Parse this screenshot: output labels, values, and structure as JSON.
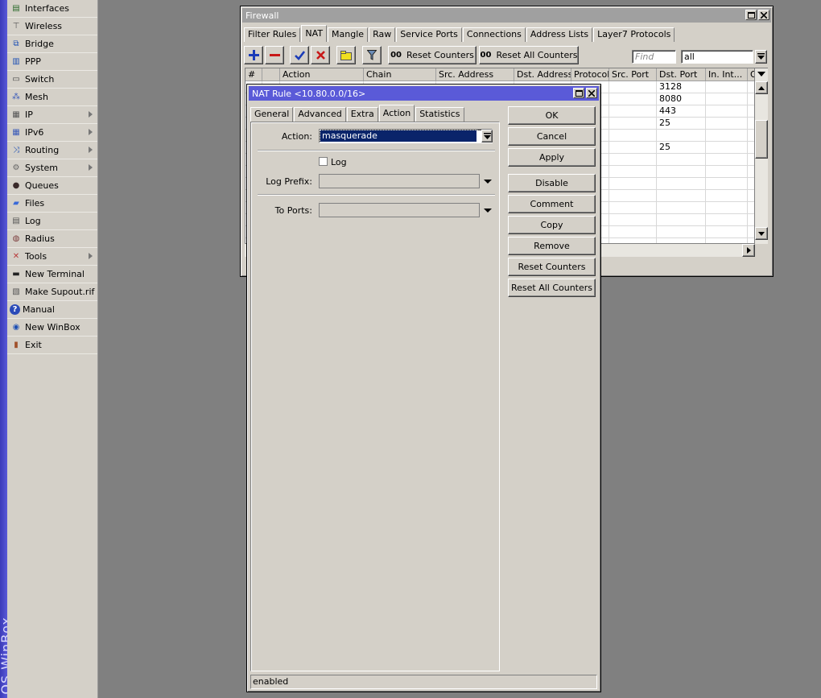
{
  "brand": {
    "text": "OS WinBox"
  },
  "menu": {
    "items": [
      {
        "label": "Interfaces",
        "icon": "interfaces-icon",
        "submenu": false
      },
      {
        "label": "Wireless",
        "icon": "wireless-icon",
        "submenu": false
      },
      {
        "label": "Bridge",
        "icon": "bridge-icon",
        "submenu": false
      },
      {
        "label": "PPP",
        "icon": "ppp-icon",
        "submenu": false
      },
      {
        "label": "Switch",
        "icon": "switch-icon",
        "submenu": false
      },
      {
        "label": "Mesh",
        "icon": "mesh-icon",
        "submenu": false
      },
      {
        "label": "IP",
        "icon": "ip-icon",
        "submenu": true
      },
      {
        "label": "IPv6",
        "icon": "ipv6-icon",
        "submenu": true
      },
      {
        "label": "Routing",
        "icon": "routing-icon",
        "submenu": true
      },
      {
        "label": "System",
        "icon": "system-gear-icon",
        "submenu": true
      },
      {
        "label": "Queues",
        "icon": "queues-icon",
        "submenu": false
      },
      {
        "label": "Files",
        "icon": "files-icon",
        "submenu": false
      },
      {
        "label": "Log",
        "icon": "log-icon",
        "submenu": false
      },
      {
        "label": "Radius",
        "icon": "radius-icon",
        "submenu": false
      },
      {
        "label": "Tools",
        "icon": "tools-icon",
        "submenu": true
      },
      {
        "label": "New Terminal",
        "icon": "terminal-icon",
        "submenu": false
      },
      {
        "label": "Make Supout.rif",
        "icon": "supout-icon",
        "submenu": false
      },
      {
        "label": "Manual",
        "icon": "help-icon",
        "submenu": false
      },
      {
        "label": "New WinBox",
        "icon": "winbox-icon",
        "submenu": false
      },
      {
        "label": "Exit",
        "icon": "exit-icon",
        "submenu": false
      }
    ]
  },
  "firewall": {
    "title": "Firewall",
    "tabs": [
      "Filter Rules",
      "NAT",
      "Mangle",
      "Raw",
      "Service Ports",
      "Connections",
      "Address Lists",
      "Layer7 Protocols"
    ],
    "active_tab": "NAT",
    "toolbar": {
      "reset_counters": "Reset Counters",
      "reset_all_counters": "Reset All Counters",
      "counter_prefix": "00",
      "find_placeholder": "Find",
      "filter_value": "all"
    },
    "columns": [
      "#",
      "",
      "Action",
      "Chain",
      "Src. Address",
      "Dst. Address",
      "Protocol",
      "Src. Port",
      "Dst. Port",
      "In. Int...",
      "O"
    ],
    "dst_ports": [
      "3128",
      "8080",
      "443",
      "25",
      "",
      "25"
    ]
  },
  "nat_rule": {
    "title": "NAT Rule <10.80.0.0/16>",
    "tabs": [
      "General",
      "Advanced",
      "Extra",
      "Action",
      "Statistics"
    ],
    "active_tab": "Action",
    "action_label": "Action:",
    "action_value": "masquerade",
    "log_label": "Log",
    "log_checked": false,
    "log_prefix_label": "Log Prefix:",
    "to_ports_label": "To Ports:",
    "buttons": {
      "ok": "OK",
      "cancel": "Cancel",
      "apply": "Apply",
      "disable": "Disable",
      "comment": "Comment",
      "copy": "Copy",
      "remove": "Remove",
      "reset_counters": "Reset Counters",
      "reset_all_counters": "Reset All Counters"
    },
    "status": "enabled"
  },
  "colors": {
    "active_title": "#5a5ad8",
    "inactive_title": "#a0a0a0",
    "selection": "#0a246a"
  }
}
